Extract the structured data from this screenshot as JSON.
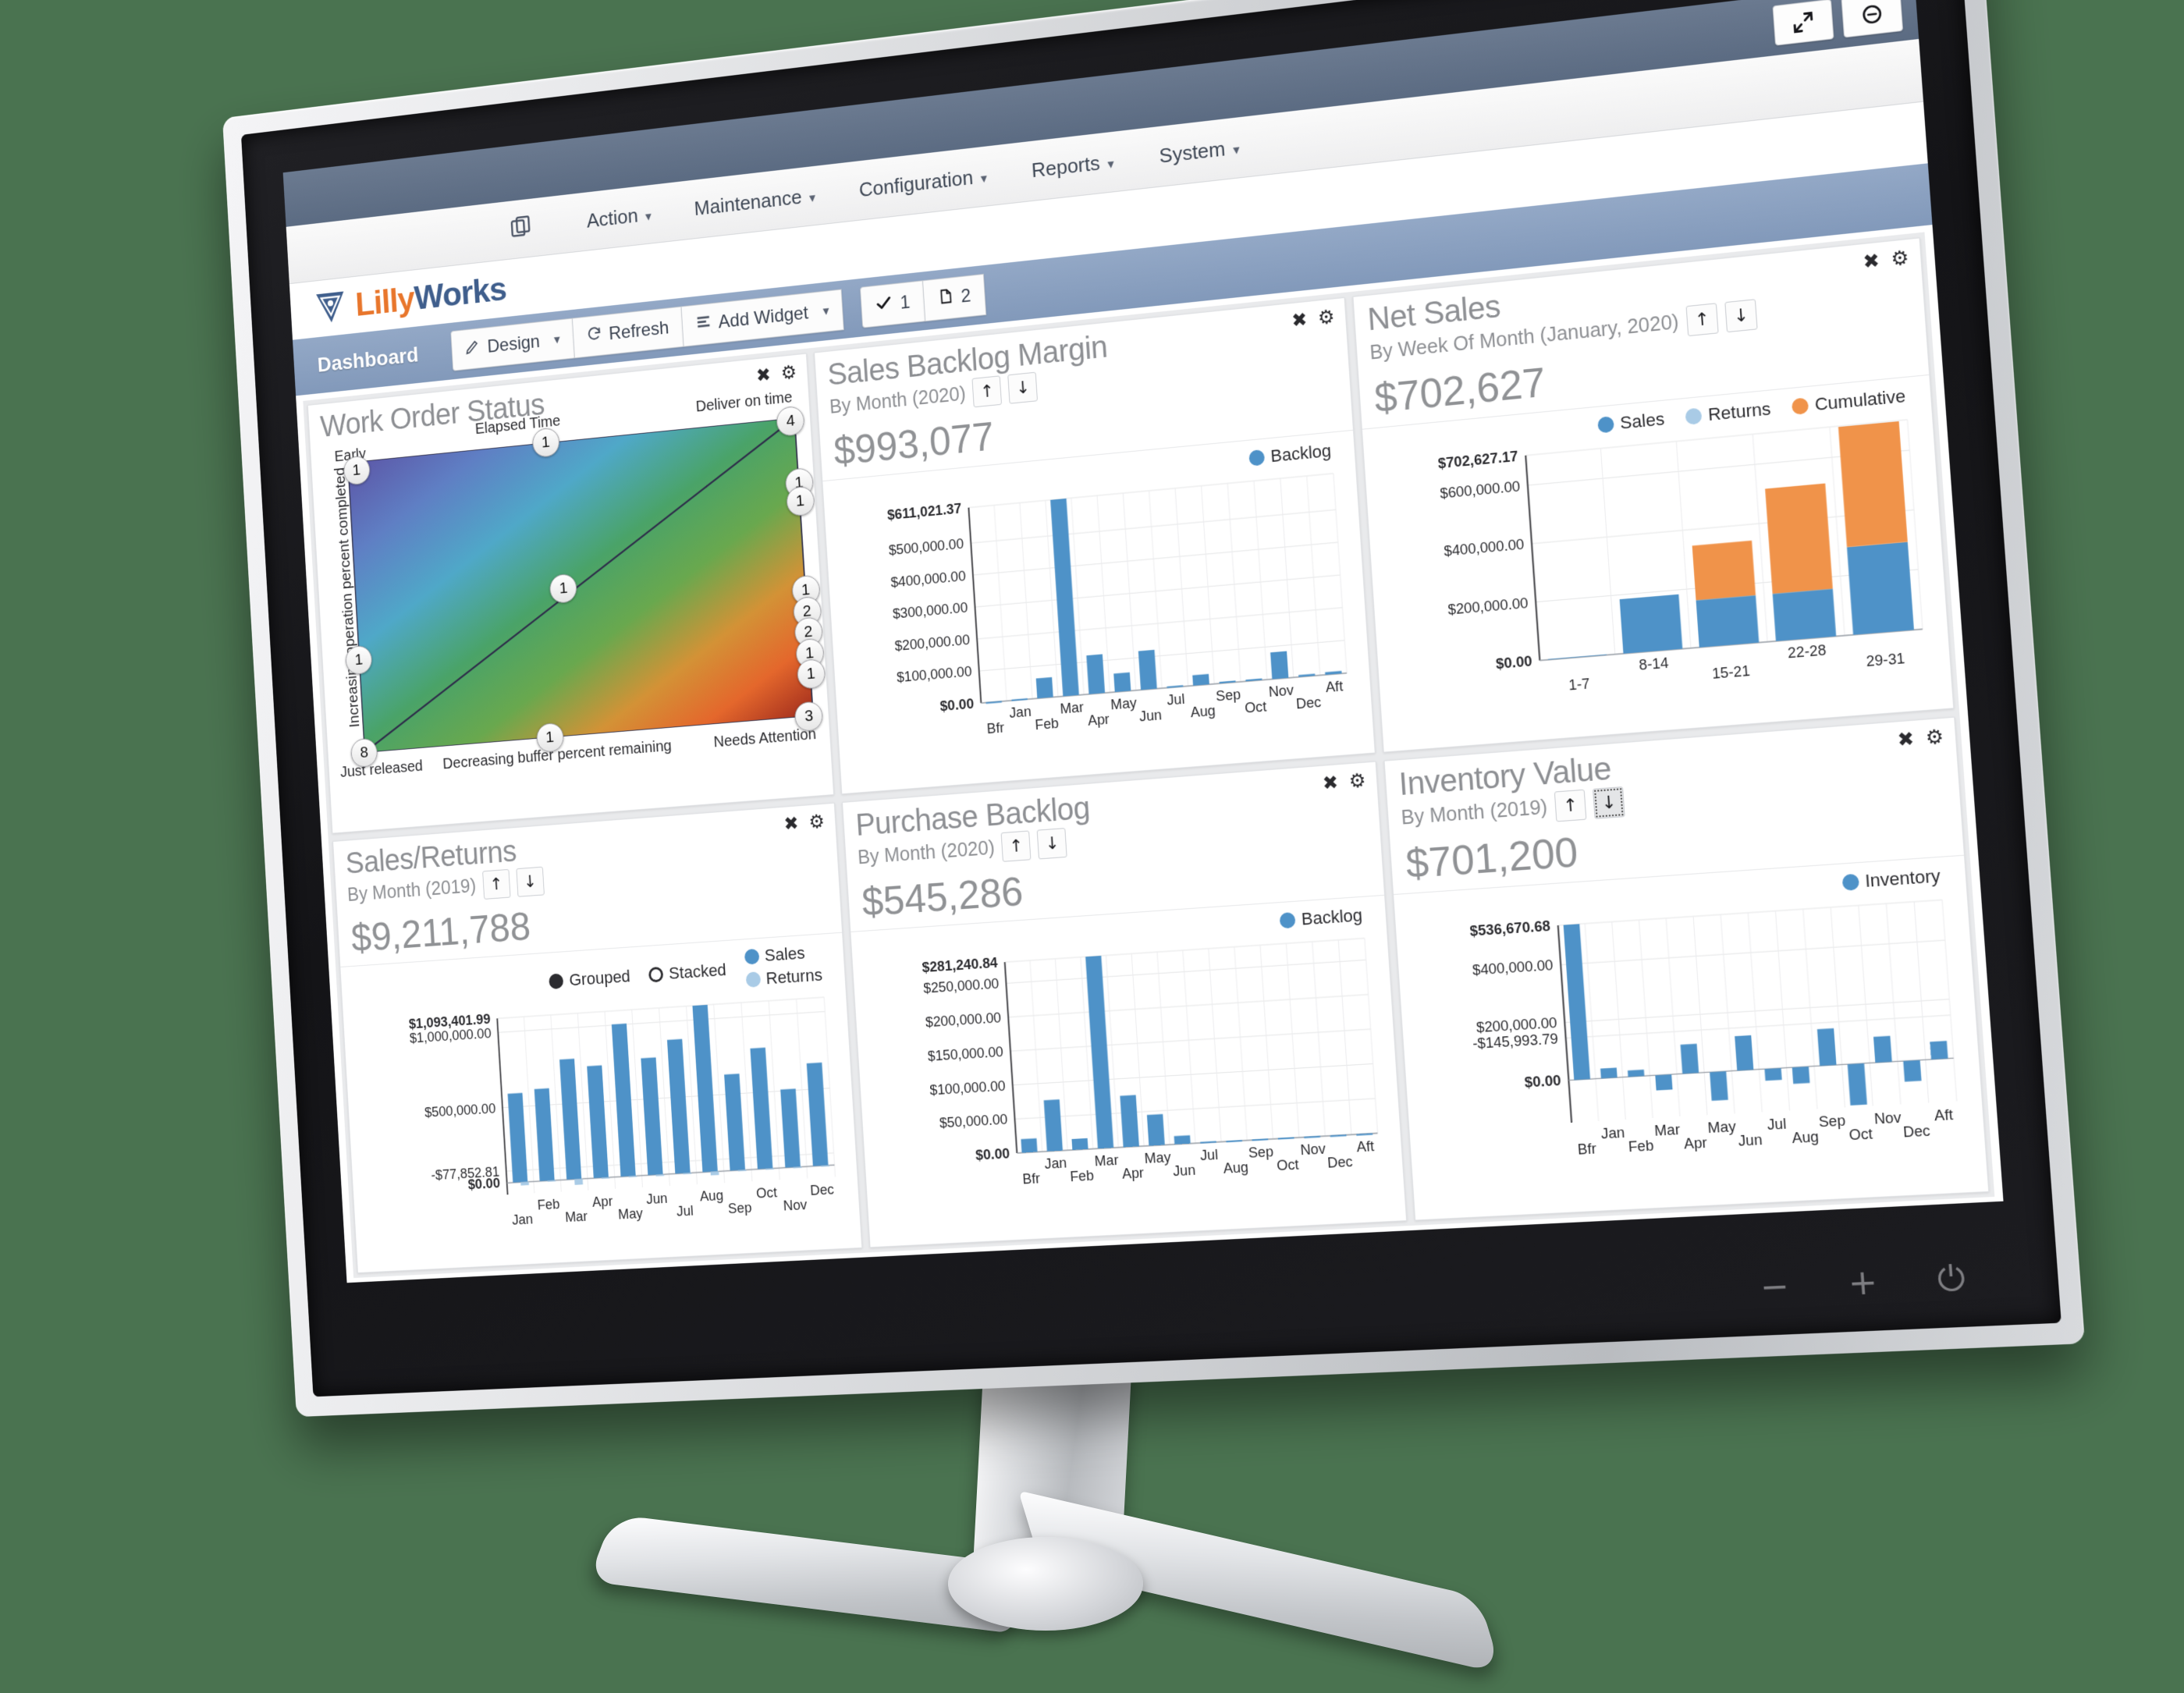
{
  "browser": {
    "restore_icon": "resize-arrow-icon",
    "secondary_icon": "circle-icon"
  },
  "menubar": {
    "copy_icon": "copy-icon",
    "items": [
      {
        "label": "Action",
        "caret": "▾"
      },
      {
        "label": "Maintenance",
        "caret": "▾"
      },
      {
        "label": "Configuration",
        "caret": "▾"
      },
      {
        "label": "Reports",
        "caret": "▾"
      },
      {
        "label": "System",
        "caret": "▾"
      }
    ]
  },
  "brand": {
    "part_a": "Lilly",
    "part_b": "Works"
  },
  "toolbar": {
    "page_label": "Dashboard",
    "design_label": "Design",
    "design_caret": "▾",
    "refresh_label": "Refresh",
    "add_widget_label": "Add Widget",
    "add_widget_caret": "▾",
    "check_badge": "1",
    "page_badge": "2"
  },
  "widget_tools": {
    "close": "✖",
    "settings": "⚙"
  },
  "arrows": {
    "up": "↑",
    "down": "↓"
  },
  "colors": {
    "series_sales": "#4e92c8",
    "series_returns": "#a9cbe6",
    "series_cumulative": "#f0934a",
    "grid": "#e2e3e5",
    "accent_brand_orange": "#e8762c",
    "accent_brand_blue": "#3f5e8c",
    "dashbar_blue": "#8299ba"
  },
  "widgets": {
    "work_order_status": {
      "title": "Work Order Status",
      "label_top_left": "Early",
      "label_top_center": "Elapsed Time",
      "label_top_right": "Deliver on time",
      "label_bottom_left": "Just released",
      "label_bottom_center": "Decreasing buffer percent remaining",
      "label_bottom_right": "Needs Attention",
      "label_y_axis": "Increasing operation percent completed"
    },
    "sales_backlog_margin": {
      "title": "Sales Backlog Margin",
      "subtitle": "By Month (2020)",
      "total": "$993,077"
    },
    "net_sales": {
      "title": "Net Sales",
      "subtitle": "By Week Of Month (January, 2020)",
      "total": "$702,627"
    },
    "sales_returns": {
      "title": "Sales/Returns",
      "subtitle": "By Month (2019)",
      "total": "$9,211,788",
      "mode_grouped": "Grouped",
      "mode_stacked": "Stacked"
    },
    "purchase_backlog": {
      "title": "Purchase Backlog",
      "subtitle": "By Month (2020)",
      "total": "$545,286"
    },
    "inventory_value": {
      "title": "Inventory Value",
      "subtitle": "By Month (2019)",
      "total": "$701,200"
    }
  },
  "chart_data": [
    {
      "id": "work_order_status",
      "type": "scatter",
      "title": "Work Order Status",
      "xlabel": "Decreasing buffer percent remaining",
      "ylabel": "Increasing operation percent completed",
      "grid": false,
      "legend": "none",
      "annotations": [
        "Early",
        "Elapsed Time",
        "Deliver on time",
        "Just released",
        "Needs Attention"
      ],
      "points": [
        {
          "x": 0.02,
          "y": 0.97,
          "count": 1
        },
        {
          "x": 0.45,
          "y": 1.0,
          "count": 1
        },
        {
          "x": 0.99,
          "y": 0.99,
          "count": 4
        },
        {
          "x": 1.0,
          "y": 0.78,
          "count": 1
        },
        {
          "x": 1.0,
          "y": 0.72,
          "count": 1
        },
        {
          "x": 0.0,
          "y": 0.32,
          "count": 1
        },
        {
          "x": 0.47,
          "y": 0.5,
          "count": 1
        },
        {
          "x": 1.0,
          "y": 0.42,
          "count": 1
        },
        {
          "x": 1.0,
          "y": 0.35,
          "count": 2
        },
        {
          "x": 1.0,
          "y": 0.28,
          "count": 2
        },
        {
          "x": 1.0,
          "y": 0.21,
          "count": 1
        },
        {
          "x": 1.0,
          "y": 0.14,
          "count": 1
        },
        {
          "x": 0.0,
          "y": 0.0,
          "count": 8
        },
        {
          "x": 0.42,
          "y": 0.0,
          "count": 1
        },
        {
          "x": 0.99,
          "y": 0.0,
          "count": 3
        }
      ]
    },
    {
      "id": "sales_backlog_margin",
      "type": "bar",
      "title": "Sales Backlog Margin",
      "subtitle": "By Month (2020)",
      "total": "$993,077",
      "ylabel": "",
      "xlabel": "",
      "grid": true,
      "legend": [
        {
          "name": "Backlog",
          "color": "#4e92c8"
        }
      ],
      "ytick_labels": [
        "$611,021.37",
        "$500,000.00",
        "$400,000.00",
        "$300,000.00",
        "$200,000.00",
        "$100,000.00",
        "$0.00"
      ],
      "ylim": [
        0,
        611021.37
      ],
      "ymax_label": "$611,021.37",
      "categories": [
        "Bfr",
        "Jan",
        "Feb",
        "Mar",
        "Apr",
        "May",
        "Jun",
        "Jul",
        "Aug",
        "Sep",
        "Oct",
        "Nov",
        "Dec",
        "Aft"
      ],
      "values": [
        1200,
        3000,
        62000,
        611021,
        120000,
        57000,
        120000,
        4000,
        32000,
        5000,
        5000,
        82000,
        6000,
        8000
      ]
    },
    {
      "id": "net_sales",
      "type": "bar",
      "title": "Net Sales",
      "subtitle": "By Week Of Month (January, 2020)",
      "total": "$702,627",
      "grid": true,
      "stacked": true,
      "legend": [
        {
          "name": "Sales",
          "color": "#4e92c8"
        },
        {
          "name": "Returns",
          "color": "#a9cbe6"
        },
        {
          "name": "Cumulative",
          "color": "#f0934a"
        }
      ],
      "ytick_labels": [
        "$702,627.17",
        "$600,000.00",
        "$400,000.00",
        "$200,000.00",
        "$0.00"
      ],
      "ylim": [
        0,
        702627.17
      ],
      "categories": [
        "1-7",
        "8-14",
        "15-21",
        "22-28",
        "29-31"
      ],
      "series": [
        {
          "name": "Sales",
          "values": [
            2000,
            185000,
            160000,
            160000,
            295000
          ]
        },
        {
          "name": "Cumulative",
          "values": [
            0,
            0,
            185000,
            355000,
            405000
          ]
        }
      ]
    },
    {
      "id": "sales_returns",
      "type": "bar",
      "title": "Sales/Returns",
      "subtitle": "By Month (2019)",
      "total": "$9,211,788",
      "grid": true,
      "legend": [
        {
          "name": "Sales",
          "color": "#4e92c8"
        },
        {
          "name": "Returns",
          "color": "#a9cbe6"
        }
      ],
      "ytick_labels": [
        "$1,093,401.99",
        "$1,000,000.00",
        "$500,000.00",
        "$0.00",
        "-$77,852.81"
      ],
      "ylim": [
        -77852.81,
        1093401.99
      ],
      "categories": [
        "Jan",
        "Feb",
        "Mar",
        "Apr",
        "May",
        "Jun",
        "Jul",
        "Aug",
        "Sep",
        "Oct",
        "Nov",
        "Dec"
      ],
      "series": [
        {
          "name": "Sales",
          "values": [
            590000,
            610000,
            795000,
            740000,
            1005000,
            770000,
            880000,
            1093402,
            630000,
            790000,
            510000,
            670000
          ]
        },
        {
          "name": "Returns",
          "values": [
            -22000,
            -5000,
            -38000,
            -4000,
            -5000,
            -10000,
            -6000,
            -24000,
            -4000,
            -3000,
            -3000,
            -4000
          ]
        }
      ]
    },
    {
      "id": "purchase_backlog",
      "type": "bar",
      "title": "Purchase Backlog",
      "subtitle": "By Month (2020)",
      "total": "$545,286",
      "grid": true,
      "legend": [
        {
          "name": "Backlog",
          "color": "#4e92c8"
        }
      ],
      "ytick_labels": [
        "$281,240.84",
        "$250,000.00",
        "$200,000.00",
        "$150,000.00",
        "$100,000.00",
        "$50,000.00",
        "$0.00"
      ],
      "ylim": [
        0,
        281240.84
      ],
      "categories": [
        "Bfr",
        "Jan",
        "Feb",
        "Mar",
        "Apr",
        "May",
        "Jun",
        "Jul",
        "Aug",
        "Sep",
        "Oct",
        "Nov",
        "Dec",
        "Aft"
      ],
      "values": [
        20000,
        75000,
        16000,
        281241,
        75000,
        45000,
        12000,
        1500,
        1000,
        1000,
        1000,
        800,
        600,
        400
      ]
    },
    {
      "id": "inventory_value",
      "type": "bar",
      "title": "Inventory Value",
      "subtitle": "By Month (2019)",
      "total": "$701,200",
      "grid": true,
      "legend": [
        {
          "name": "Inventory",
          "color": "#4e92c8"
        }
      ],
      "ytick_labels": [
        "$536,670.68",
        "$400,000.00",
        "$200,000.00",
        "$0.00",
        "-$145,993.79"
      ],
      "ylim": [
        -145993.79,
        536670.68
      ],
      "categories": [
        "Bfr",
        "Jan",
        "Feb",
        "Mar",
        "Apr",
        "May",
        "Jun",
        "Jul",
        "Aug",
        "Sep",
        "Oct",
        "Nov",
        "Dec",
        "Aft"
      ],
      "values": [
        536671,
        34000,
        22000,
        -52000,
        100000,
        -98000,
        118000,
        -40000,
        -56000,
        125000,
        -140000,
        88000,
        -70000,
        60000
      ]
    }
  ]
}
